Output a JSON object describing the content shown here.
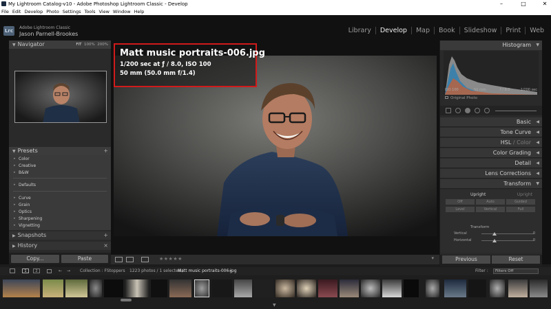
{
  "window": {
    "title": "My Lightroom Catalog-v10 - Adobe Photoshop Lightroom Classic - Develop",
    "controls": [
      "–",
      "□",
      "✕"
    ]
  },
  "menu": [
    "File",
    "Edit",
    "Develop",
    "Photo",
    "Settings",
    "Tools",
    "View",
    "Window",
    "Help"
  ],
  "identity": {
    "logo": "Lrc",
    "product": "Adobe Lightroom Classic",
    "user": "Jason Parnell-Brookes"
  },
  "modules": [
    {
      "label": "Library",
      "active": false
    },
    {
      "label": "Develop",
      "active": true
    },
    {
      "label": "Map",
      "active": false
    },
    {
      "label": "Book",
      "active": false
    },
    {
      "label": "Slideshow",
      "active": false
    },
    {
      "label": "Print",
      "active": false
    },
    {
      "label": "Web",
      "active": false
    }
  ],
  "navigator": {
    "title": "Navigator",
    "zoom_options": [
      "FIT",
      "100%",
      "200%"
    ],
    "zoom_selected": "FIT"
  },
  "presets": {
    "title": "Presets",
    "groups": [
      [
        "Color",
        "Creative",
        "B&W"
      ],
      [
        "Defaults"
      ],
      [
        "Curve",
        "Grain",
        "Optics",
        "Sharpening",
        "Vignetting"
      ]
    ]
  },
  "snapshots": {
    "title": "Snapshots"
  },
  "history": {
    "title": "History"
  },
  "left_buttons": {
    "copy": "Copy...",
    "paste": "Paste"
  },
  "photo_info": {
    "filename": "Matt music portraits-006.jpg",
    "exposure": "1/200 sec at ƒ / 8.0, ISO 100",
    "lens": "50 mm (50.0 mm f/1.4)"
  },
  "toolbar": {
    "rating": "★★★★★"
  },
  "histogram": {
    "title": "Histogram",
    "iso": "ISO 100",
    "focal": "50 mm",
    "aperture": "f / 8.0",
    "shutter": "1/200 sec",
    "original_label": "Original Photo"
  },
  "develop_panels": [
    "Basic",
    "Tone Curve",
    "HSL",
    "Color",
    "Color Grading",
    "Detail",
    "Lens Corrections",
    "Transform"
  ],
  "transform": {
    "upright_label": "Upright",
    "upright_right": "Upright",
    "buttons_row1": [
      "Off",
      "Auto",
      "Guided"
    ],
    "buttons_row2": [
      "Level",
      "Vertical",
      "Full"
    ],
    "section": "Transform",
    "sliders": [
      {
        "label": "Vertical",
        "value": "0"
      },
      {
        "label": "Horizontal",
        "value": "0"
      }
    ]
  },
  "right_buttons": {
    "previous": "Previous",
    "reset": "Reset"
  },
  "filmstrip": {
    "screen_labels": [
      "1",
      "2"
    ],
    "source": "Collection : FStoppers",
    "count": "1223 photos / 1 selected /",
    "selected": "Matt music portraits-006.jpg",
    "filter_label": "Filter :",
    "filter_value": "Filters Off"
  },
  "colors": {
    "accent_red": "#d11a1a",
    "panel_bg": "#2a2a2a",
    "active_module": "#f0f0f0"
  }
}
